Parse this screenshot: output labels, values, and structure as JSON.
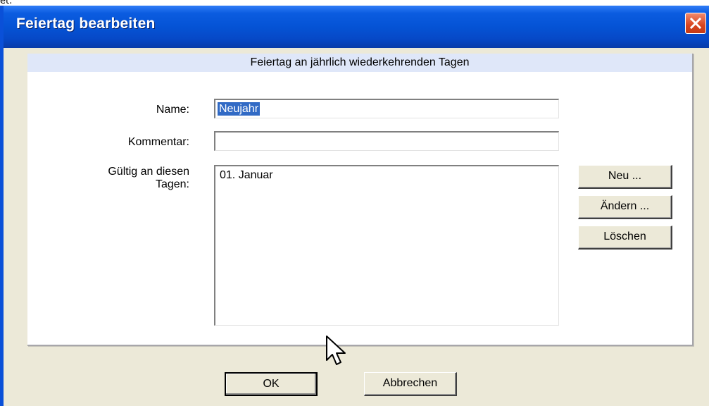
{
  "window": {
    "title": "Feiertag bearbeiten"
  },
  "stray_text": "et.",
  "panel": {
    "header": "Feiertag an jährlich wiederkehrenden Tagen"
  },
  "form": {
    "name_label": "Name:",
    "name_value": "Neujahr",
    "comment_label": "Kommentar:",
    "comment_value": "",
    "days_label_line1": "Gültig an diesen",
    "days_label_line2": "Tagen:",
    "days_list": [
      "01. Januar"
    ]
  },
  "buttons": {
    "new": "Neu ...",
    "edit": "Ändern ...",
    "delete": "Löschen",
    "ok": "OK",
    "cancel": "Abbrechen"
  },
  "colors": {
    "titlebar": "#0553d5",
    "header_bg": "#dfe7f9",
    "selection": "#316ac5",
    "close_button": "#d8441f"
  },
  "icons": {
    "close": "close-icon",
    "cursor": "mouse-pointer-icon"
  }
}
